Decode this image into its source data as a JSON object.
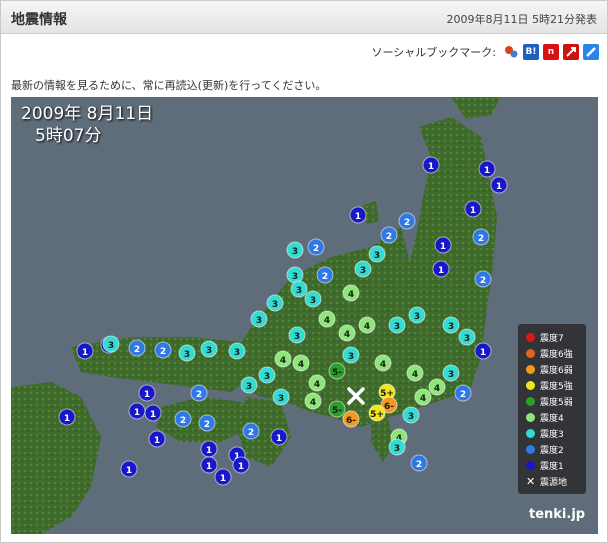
{
  "header": {
    "title": "地震情報",
    "date": "2009年8月11日 5時21分発表"
  },
  "social": {
    "label": "ソーシャルブックマーク:",
    "icons": [
      {
        "name": "bookmark-icon-1",
        "color": "#e04020"
      },
      {
        "name": "hatena-bookmark-icon",
        "color": "#1f5fbf",
        "glyph": "B!"
      },
      {
        "name": "bookmark-icon-3",
        "color": "#d81010",
        "glyph": "n"
      },
      {
        "name": "bookmark-icon-4",
        "color": "#cc1111"
      },
      {
        "name": "bookmark-icon-5",
        "color": "#2a86e6"
      }
    ]
  },
  "note": "最新の情報を見るために、常に再読込(更新)を行ってください。",
  "map": {
    "stamp_date": "2009年  8月11日",
    "stamp_time": "5時07分",
    "brand": "tenki.jp",
    "legend": [
      {
        "label": "震度7",
        "color": "#d91818"
      },
      {
        "label": "震度6強",
        "color": "#e0641e"
      },
      {
        "label": "震度6弱",
        "color": "#f39a1e"
      },
      {
        "label": "震度5強",
        "color": "#f0e61e"
      },
      {
        "label": "震度5弱",
        "color": "#28a028"
      },
      {
        "label": "震度4",
        "color": "#8ee67a"
      },
      {
        "label": "震度3",
        "color": "#32dcd2"
      },
      {
        "label": "震度2",
        "color": "#2f78e6"
      },
      {
        "label": "震度1",
        "color": "#1818c8"
      },
      {
        "label": "震源地",
        "color": "#ffffff",
        "glyph": "✕"
      }
    ],
    "markers": [
      {
        "v": "1",
        "c": "#1818c8"
      },
      {
        "v": "2",
        "c": "#2f78e6"
      },
      {
        "v": "3",
        "c": "#32dcd2"
      },
      {
        "v": "4",
        "c": "#8ee67a"
      },
      {
        "v": "5-",
        "c": "#28a028"
      },
      {
        "v": "5+",
        "c": "#f0e61e"
      },
      {
        "v": "6-",
        "c": "#f39a1e"
      }
    ]
  }
}
